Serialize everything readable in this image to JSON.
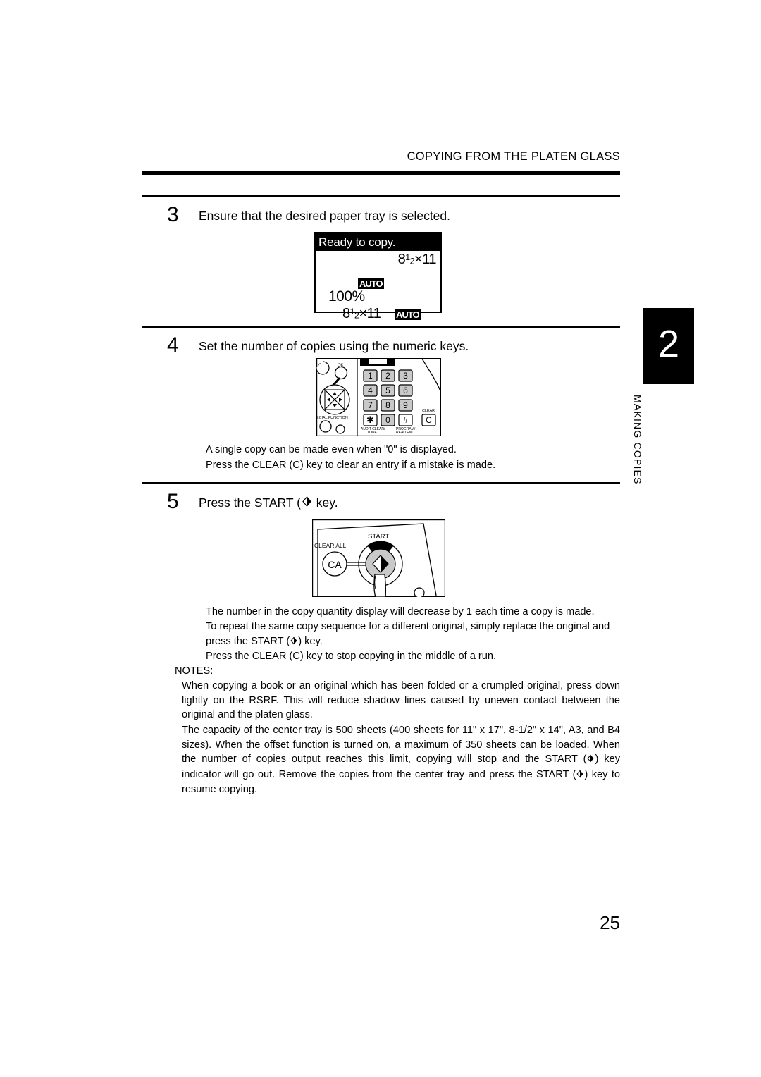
{
  "header": {
    "running_head": "COPYING FROM THE PLATEN GLASS"
  },
  "steps": [
    {
      "number": "3",
      "text": "Ensure that the desired paper tray is selected."
    },
    {
      "number": "4",
      "text": "Set the number of copies using the numeric keys."
    },
    {
      "number": "5",
      "text_before": "Press the START (",
      "text_after": " key."
    }
  ],
  "lcd": {
    "title": "Ready to copy.",
    "paper_size_top": "8½x11",
    "exposure_auto": "AUTO",
    "zoom_percent": "100%",
    "paper_size_bottom": "8½x11",
    "paper_auto": "AUTO"
  },
  "keypad": {
    "keys": [
      "1",
      "2",
      "3",
      "4",
      "5",
      "6",
      "7",
      "8",
      "9"
    ],
    "star_key": "✱",
    "zero_key": "0",
    "hash_key": "#",
    "clear_key": "C",
    "clear_label": "CLEAR",
    "audit_label_line1": "AUDIT CLEAR/",
    "audit_label_line2": "TONE",
    "program_label_line1": "PROGRAM/",
    "program_label_line2": "READ END",
    "ok_label": "OK",
    "back_label": "CK",
    "special_function_label": "ECIAL FUNCTION"
  },
  "start_panel": {
    "start_label": "START",
    "clear_all_label": "CLEAR ALL",
    "ca_label": "CA"
  },
  "step4_notes": [
    "A single copy can be made even when \"0\" is displayed.",
    "Press the CLEAR (C) key to clear an entry if a mistake is made."
  ],
  "step5_notes": {
    "line1": "The number in the copy quantity display will decrease by 1 each time a copy is made.",
    "line2_before": "To repeat the same copy sequence for a different original, simply replace the original and press the START (",
    "line2_after": ") key.",
    "line3": "Press the CLEAR (C) key to stop copying in the middle of a run."
  },
  "notes": {
    "heading": "NOTES:",
    "note1": "When copying a book or an original which has been folded or a crumpled original, press down lightly on the RSRF. This will reduce shadow lines caused by uneven contact between the original and the platen glass.",
    "note2_part1": "The capacity of the center tray is 500 sheets (400 sheets for 11\" x 17\", 8-1/2\" x 14\", A3, and B4 sizes). When the offset function is turned on, a maximum of 350 sheets can be loaded. When the number of copies output reaches this limit, copying will stop and the START (",
    "note2_part2": ") key indicator will go out. Remove the copies from the center tray and press the START (",
    "note2_part3": ") key to resume copying."
  },
  "chapter": {
    "number": "2",
    "label": "MAKING COPIES"
  },
  "footer": {
    "page_number": "25"
  },
  "colors": {
    "ink": "#000000",
    "paper": "#ffffff",
    "key_fill": "#c9c9c9"
  }
}
